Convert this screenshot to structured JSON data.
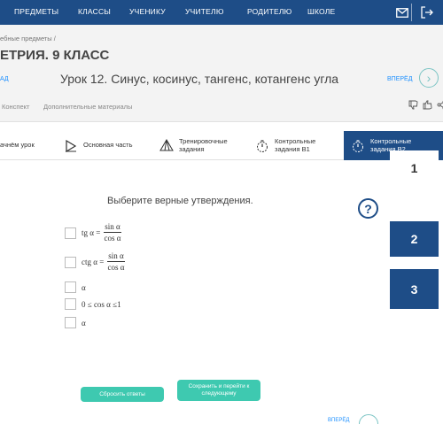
{
  "topnav": {
    "items": [
      "ПРЕДМЕТЫ",
      "КЛАССЫ",
      "УЧЕНИКУ",
      "УЧИТЕЛЮ",
      "РОДИТЕЛЮ",
      "ШКОЛЕ"
    ]
  },
  "header": {
    "breadcrumb": "ебные предметы  /",
    "course_title": "ЕТРИЯ. 9 КЛАСС",
    "back_label": "АД",
    "lesson_title": "Урок 12. Синус, косинус, тангенс, котангенс угла",
    "forward_label": "ВПЕРЁД",
    "subnav": [
      "Конспект",
      "Дополнительные материалы"
    ]
  },
  "tabs": [
    {
      "label": "ачнём урок",
      "icon": "partial"
    },
    {
      "label": "Основная часть",
      "icon": "play-icon"
    },
    {
      "label": "Тренировочные задания",
      "icon": "pyramid-icon"
    },
    {
      "label": "Контрольные задания В1",
      "icon": "timer-icon"
    },
    {
      "label": "Контрольные задания В2",
      "icon": "timer-icon"
    }
  ],
  "question": {
    "prompt": "Выберите верные утверждения.",
    "help": "?",
    "answers": [
      {
        "prefix": "tg α =",
        "num": "sin α",
        "den": "cos α"
      },
      {
        "prefix": "ctg α =",
        "num": "sin α",
        "den": "cos  α"
      },
      {
        "prefix": "α"
      },
      {
        "prefix": "0 ≤ cos α ≤1"
      },
      {
        "prefix": "α"
      }
    ]
  },
  "question_numbers": [
    "1",
    "2",
    "3"
  ],
  "buttons": {
    "reset": "Сбросить ответы",
    "save_next": "Сохранить и перейти к следующему"
  },
  "bottom": {
    "next_label": "ВПЕРЁД"
  },
  "colors": {
    "nav": "#1e4d87",
    "accent": "#3ec9b0",
    "link": "#1e90ff"
  }
}
